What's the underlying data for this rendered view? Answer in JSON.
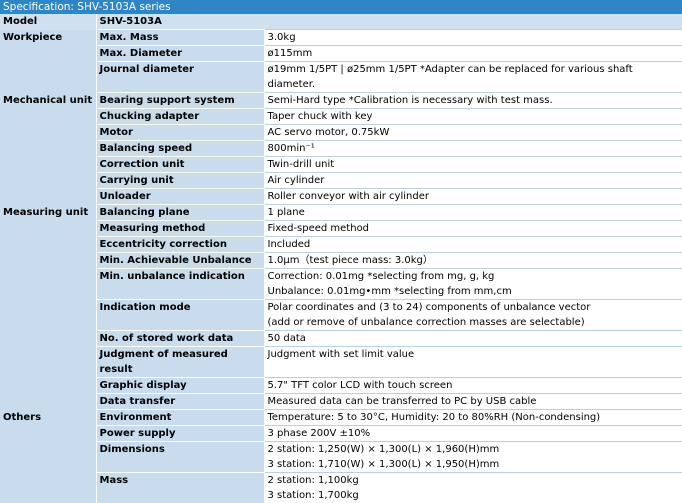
{
  "title": "Specification: SHV-5103A series",
  "header": {
    "col1": "Model",
    "col2": "SHV-5103A"
  },
  "rows": [
    {
      "cat": "Workpiece",
      "item": "Max. Mass",
      "lines": [
        "3.0kg"
      ]
    },
    {
      "cat": "",
      "item": "Max. Diameter",
      "lines": [
        "ø115mm"
      ]
    },
    {
      "cat": "",
      "item": "Journal diameter",
      "lines": [
        "ø19mm 1/5PT | ø25mm 1/5PT *Adapter can be replaced for various shaft diameter."
      ]
    },
    {
      "cat": "Mechanical unit",
      "item": "Bearing support system",
      "lines": [
        "Semi-Hard type *Calibration is necessary with test mass."
      ]
    },
    {
      "cat": "",
      "item": "Chucking adapter",
      "lines": [
        "Taper chuck with key"
      ]
    },
    {
      "cat": "",
      "item": "Motor",
      "lines": [
        "AC servo motor, 0.75kW"
      ]
    },
    {
      "cat": "",
      "item": "Balancing speed",
      "lines": [
        "800min⁻¹"
      ]
    },
    {
      "cat": "",
      "item": "Correction unit",
      "lines": [
        "Twin-drill unit"
      ]
    },
    {
      "cat": "",
      "item": "Carrying unit",
      "lines": [
        "Air cylinder"
      ]
    },
    {
      "cat": "",
      "item": "Unloader",
      "lines": [
        "Roller conveyor with air cylinder"
      ]
    },
    {
      "cat": "Measuring unit",
      "item": "Balancing plane",
      "lines": [
        "1 plane"
      ]
    },
    {
      "cat": "",
      "item": "Measuring method",
      "lines": [
        "Fixed-speed method"
      ]
    },
    {
      "cat": "",
      "item": "Eccentricity correction",
      "lines": [
        "Included"
      ]
    },
    {
      "cat": "",
      "item": "Min. Achievable Unbalance",
      "lines": [
        "1.0μm（test piece mass: 3.0kg）"
      ]
    },
    {
      "cat": "",
      "item": "Min. unbalance indication",
      "lines": [
        "Correction: 0.01mg *selecting from mg, g, kg",
        "Unbalance: 0.01mg•mm *selecting from mm,cm"
      ]
    },
    {
      "cat": "",
      "item": "Indication mode",
      "lines": [
        "Polar coordinates and (3 to 24) components of unbalance vector",
        "(add or remove of unbalance correction masses are selectable)"
      ]
    },
    {
      "cat": "",
      "item": "No. of stored work data",
      "lines": [
        "50 data"
      ]
    },
    {
      "cat": "",
      "item": "Judgment of measured result",
      "lines": [
        "Judgment with set limit value"
      ]
    },
    {
      "cat": "",
      "item": "Graphic display",
      "lines": [
        "5.7\" TFT color LCD with touch screen"
      ]
    },
    {
      "cat": "",
      "item": "Data transfer",
      "lines": [
        "Measured data can be transferred to PC by USB cable"
      ]
    },
    {
      "cat": "Others",
      "item": "Environment",
      "lines": [
        "Temperature: 5 to 30°C, Humidity: 20 to 80%RH (Non-condensing)"
      ]
    },
    {
      "cat": "",
      "item": "Power supply",
      "lines": [
        "3 phase 200V ±10%"
      ]
    },
    {
      "cat": "",
      "item": "Dimensions",
      "lines": [
        "2 station: 1,250(W) × 1,300(L) × 1,960(H)mm",
        "3 station: 1,710(W) × 1,300(L) × 1,950(H)mm"
      ]
    },
    {
      "cat": "",
      "item": "Mass",
      "lines": [
        "2 station: 1,100kg",
        "3 station: 1,700kg"
      ]
    }
  ],
  "groups": [
    {
      "cat": "Workpiece",
      "start": 0,
      "span": 3
    },
    {
      "cat": "Mechanical unit",
      "start": 3,
      "span": 7
    },
    {
      "cat": "Measuring unit",
      "start": 10,
      "span": 10
    },
    {
      "cat": "Others",
      "start": 20,
      "span": 4
    }
  ],
  "tall_rows": {
    "15": 2
  },
  "colors": {
    "title_bg": "#2f86c4",
    "label_bg": "#c8dcee",
    "value_bg": "#ffffff"
  }
}
